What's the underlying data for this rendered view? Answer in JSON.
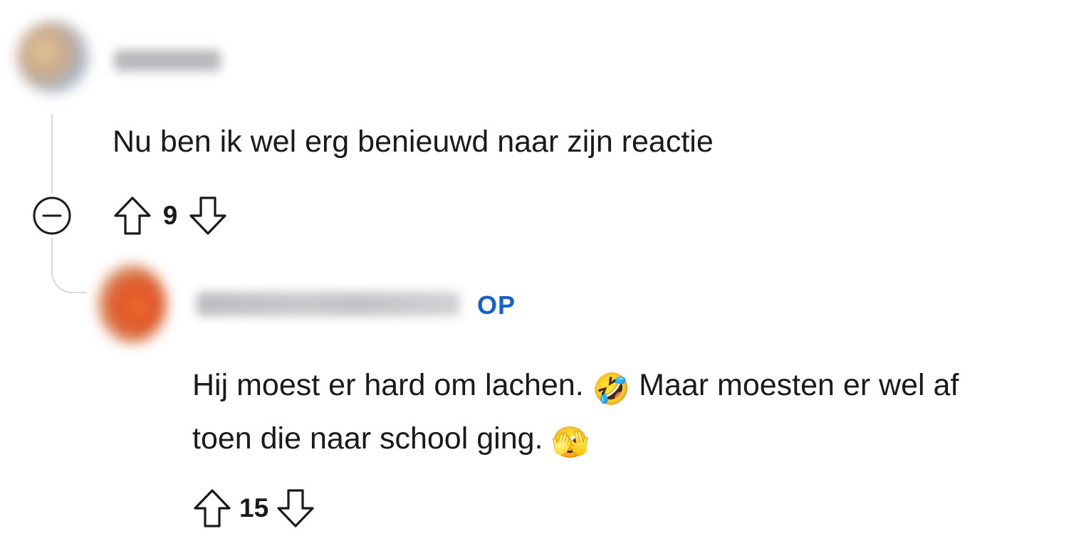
{
  "comments": [
    {
      "body": "Nu ben ik wel erg benieuwd naar zijn reactie",
      "votes": "9",
      "icons": {
        "collapse": "minus-circle-icon",
        "upvote": "arrow-up-icon",
        "downvote": "arrow-down-icon"
      }
    },
    {
      "badge": "OP",
      "body_line1_part1": "Hij moest er hard om lachen. ",
      "body_line1_emoji": "🤣",
      "body_line1_part2": " Maar moesten er wel af",
      "body_line2_part1": "toen die naar school ging. ",
      "body_line2_emoji": "🫣",
      "votes": "15",
      "icons": {
        "upvote": "arrow-up-icon",
        "downvote": "arrow-down-icon"
      }
    }
  ],
  "colors": {
    "op_badge": "#1661c9",
    "text": "#1a1a1b",
    "thread_line": "#dadada"
  }
}
